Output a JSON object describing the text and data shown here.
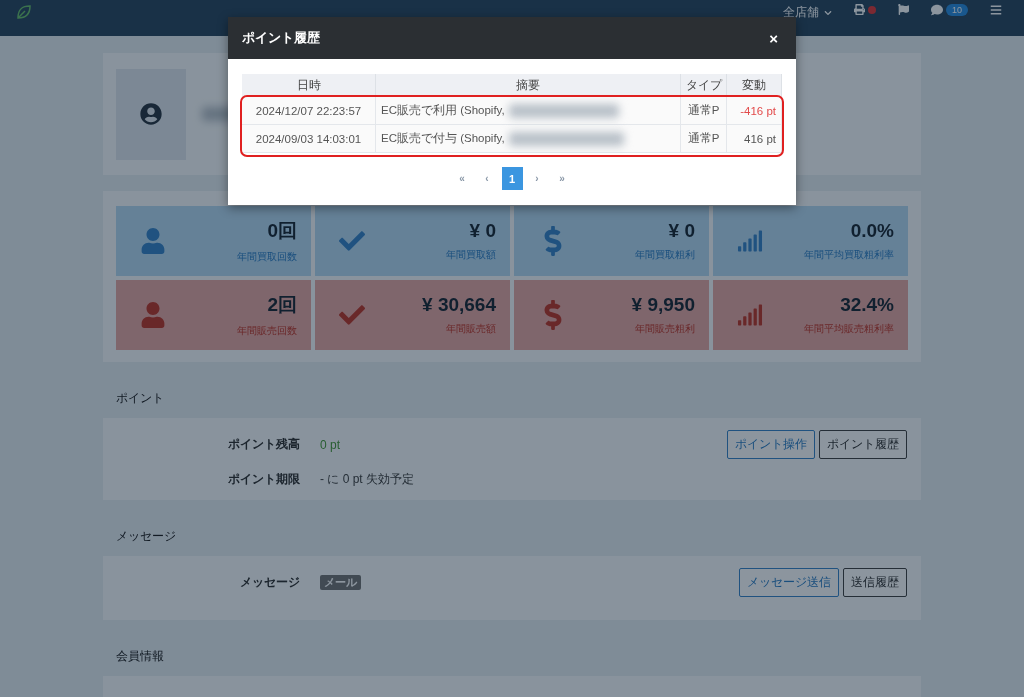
{
  "topbar": {
    "store_selector": "全店舗",
    "notification_count": "10",
    "printer_alert": true
  },
  "stats": [
    {
      "kind": "purchase",
      "value": "0回",
      "label": "年間買取回数"
    },
    {
      "kind": "purchase",
      "value": "¥ 0",
      "label": "年間買取額"
    },
    {
      "kind": "purchase",
      "value": "¥ 0",
      "label": "年間買取粗利"
    },
    {
      "kind": "purchase",
      "value": "0.0%",
      "label": "年間平均買取粗利率"
    },
    {
      "kind": "sales",
      "value": "2回",
      "label": "年間販売回数"
    },
    {
      "kind": "sales",
      "value": "¥ 30,664",
      "label": "年間販売額"
    },
    {
      "kind": "sales",
      "value": "¥ 9,950",
      "label": "年間販売粗利"
    },
    {
      "kind": "sales",
      "value": "32.4%",
      "label": "年間平均販売粗利率"
    }
  ],
  "sections": [
    {
      "title": "ポイント",
      "rows": [
        {
          "label": "ポイント残高",
          "kind": "balance",
          "value": "0 pt"
        },
        {
          "label": "ポイント期限",
          "kind": "text",
          "value": "- に 0 pt 失効予定"
        }
      ],
      "buttons": [
        {
          "label": "ポイント操作",
          "primary": true
        },
        {
          "label": "ポイント履歴",
          "primary": false
        }
      ]
    },
    {
      "title": "メッセージ",
      "rows": [
        {
          "label": "メッセージ",
          "kind": "badge",
          "value": "メール"
        }
      ],
      "buttons": [
        {
          "label": "メッセージ送信",
          "primary": true
        },
        {
          "label": "送信履歴",
          "primary": false
        }
      ]
    },
    {
      "title": "会員情報"
    }
  ],
  "modal": {
    "title": "ポイント履歴",
    "close": "×",
    "columns": [
      "日時",
      "摘要",
      "タイプ",
      "変動"
    ],
    "highlighted": true,
    "rows": [
      {
        "date": "2024/12/07 22:23:57",
        "summary": "EC販売で利用 (Shopify,",
        "type": "通常P",
        "change": "-416 pt",
        "negative": true
      },
      {
        "date": "2024/09/03 14:03:01",
        "summary": "EC販売で付与 (Shopify,",
        "type": "通常P",
        "change": "416 pt",
        "negative": false
      }
    ],
    "pagination": {
      "first": "«",
      "prev": "‹",
      "pages": [
        {
          "label": "1",
          "selected": true
        }
      ],
      "next": "›",
      "last": "»"
    }
  }
}
